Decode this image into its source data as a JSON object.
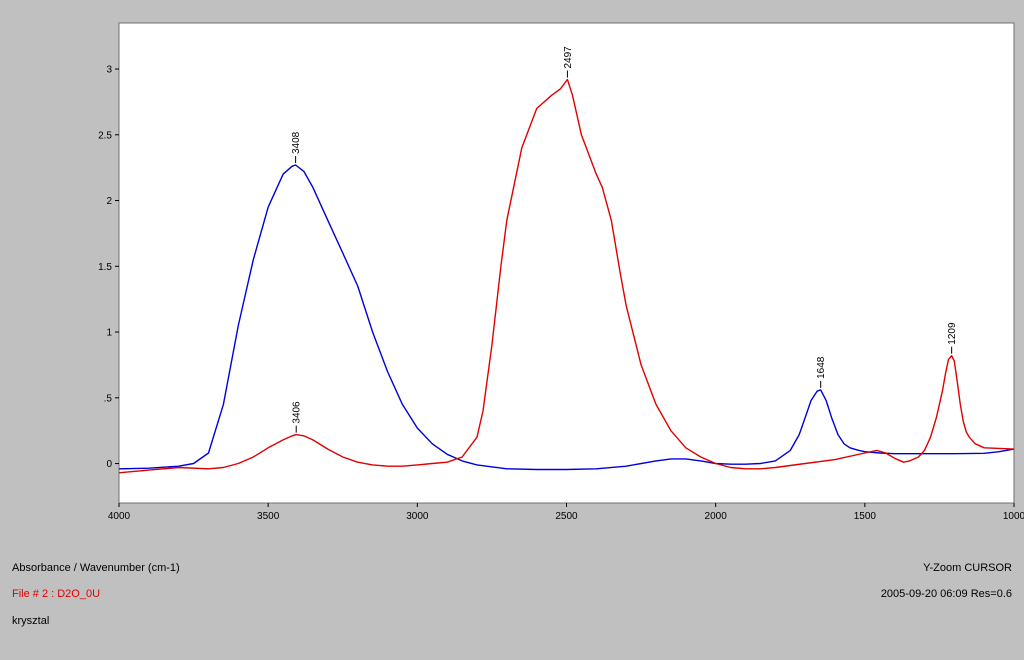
{
  "footer": {
    "axis_title": "Absorbance / Wavenumber (cm-1)",
    "file_line": "File # 2 : D2O_0U",
    "sample_name": "krysztal",
    "zoom_mode": "Y-Zoom CURSOR",
    "file_meta": "2005-09-20  06:09  Res=0.6"
  },
  "colors": {
    "series_blue": "#0000dd",
    "series_red": "#e00000",
    "plot_background": "#ffffff",
    "window_background": "#c0c0c0",
    "file_line_text": "#e00000"
  },
  "chart_data": {
    "type": "line",
    "title": "",
    "xlabel": "Absorbance / Wavenumber (cm-1)",
    "ylabel": "",
    "xlim": [
      4000,
      1000
    ],
    "ylim": [
      -0.3,
      3.35
    ],
    "x_reversed": true,
    "grid": false,
    "legend": "none",
    "x_ticks": [
      4000,
      3500,
      3000,
      2500,
      2000,
      1500,
      1000
    ],
    "x_tick_labels": [
      "4000",
      "3500",
      "3000",
      "2500",
      "2000",
      "1500",
      "1000"
    ],
    "y_ticks": [
      0,
      0.5,
      1,
      1.5,
      2,
      2.5,
      3
    ],
    "y_tick_labels": [
      "0",
      ".5",
      "1",
      "1.5",
      "2",
      "2.5",
      "3"
    ],
    "series": [
      {
        "color": "#0000dd",
        "x": [
          4000,
          3900,
          3800,
          3750,
          3700,
          3650,
          3600,
          3550,
          3500,
          3450,
          3420,
          3408,
          3380,
          3350,
          3300,
          3250,
          3200,
          3150,
          3100,
          3050,
          3000,
          2950,
          2900,
          2850,
          2800,
          2700,
          2600,
          2500,
          2400,
          2300,
          2200,
          2150,
          2100,
          2050,
          2000,
          1950,
          1900,
          1850,
          1800,
          1750,
          1720,
          1700,
          1680,
          1660,
          1648,
          1630,
          1610,
          1590,
          1570,
          1550,
          1520,
          1500,
          1450,
          1400,
          1300,
          1200,
          1100,
          1050,
          1000
        ],
        "y": [
          -0.04,
          -0.035,
          -0.02,
          0.0,
          0.08,
          0.45,
          1.05,
          1.55,
          1.95,
          2.2,
          2.26,
          2.27,
          2.22,
          2.1,
          1.85,
          1.6,
          1.35,
          1.0,
          0.7,
          0.45,
          0.27,
          0.15,
          0.07,
          0.02,
          -0.01,
          -0.04,
          -0.045,
          -0.045,
          -0.04,
          -0.02,
          0.02,
          0.035,
          0.035,
          0.02,
          0.0,
          -0.005,
          -0.005,
          0.0,
          0.02,
          0.1,
          0.22,
          0.35,
          0.48,
          0.55,
          0.56,
          0.48,
          0.34,
          0.22,
          0.15,
          0.12,
          0.1,
          0.09,
          0.08,
          0.075,
          0.075,
          0.075,
          0.078,
          0.09,
          0.11
        ]
      },
      {
        "color": "#e00000",
        "x": [
          4000,
          3900,
          3800,
          3700,
          3650,
          3600,
          3550,
          3500,
          3450,
          3420,
          3406,
          3380,
          3350,
          3300,
          3250,
          3200,
          3150,
          3100,
          3050,
          3000,
          2950,
          2900,
          2850,
          2800,
          2780,
          2750,
          2720,
          2700,
          2650,
          2600,
          2550,
          2520,
          2497,
          2480,
          2450,
          2400,
          2380,
          2350,
          2320,
          2300,
          2250,
          2200,
          2150,
          2100,
          2050,
          2000,
          1950,
          1900,
          1850,
          1800,
          1700,
          1600,
          1500,
          1460,
          1430,
          1400,
          1370,
          1350,
          1320,
          1300,
          1280,
          1260,
          1240,
          1230,
          1220,
          1209,
          1200,
          1190,
          1180,
          1170,
          1160,
          1150,
          1130,
          1100,
          1050,
          1000
        ],
        "y": [
          -0.07,
          -0.05,
          -0.03,
          -0.04,
          -0.03,
          0.0,
          0.05,
          0.12,
          0.18,
          0.21,
          0.22,
          0.21,
          0.18,
          0.11,
          0.05,
          0.01,
          -0.01,
          -0.02,
          -0.02,
          -0.01,
          0.0,
          0.01,
          0.05,
          0.2,
          0.4,
          0.9,
          1.5,
          1.85,
          2.4,
          2.7,
          2.8,
          2.85,
          2.92,
          2.8,
          2.5,
          2.2,
          2.1,
          1.85,
          1.45,
          1.2,
          0.75,
          0.45,
          0.25,
          0.12,
          0.05,
          0.0,
          -0.03,
          -0.04,
          -0.04,
          -0.03,
          0.0,
          0.03,
          0.08,
          0.1,
          0.08,
          0.04,
          0.01,
          0.02,
          0.05,
          0.1,
          0.2,
          0.35,
          0.55,
          0.68,
          0.79,
          0.82,
          0.78,
          0.62,
          0.45,
          0.32,
          0.24,
          0.2,
          0.15,
          0.12,
          0.115,
          0.11
        ]
      }
    ],
    "annotations": [
      {
        "x": 3408,
        "y": 2.27,
        "text": "3408",
        "color": "#0000dd"
      },
      {
        "x": 3406,
        "y": 0.22,
        "text": "3406",
        "color": "#e00000"
      },
      {
        "x": 2497,
        "y": 2.92,
        "text": "2497",
        "color": "#e00000"
      },
      {
        "x": 1648,
        "y": 0.56,
        "text": "1648",
        "color": "#0000dd"
      },
      {
        "x": 1209,
        "y": 0.82,
        "text": "1209",
        "color": "#e00000"
      }
    ]
  }
}
